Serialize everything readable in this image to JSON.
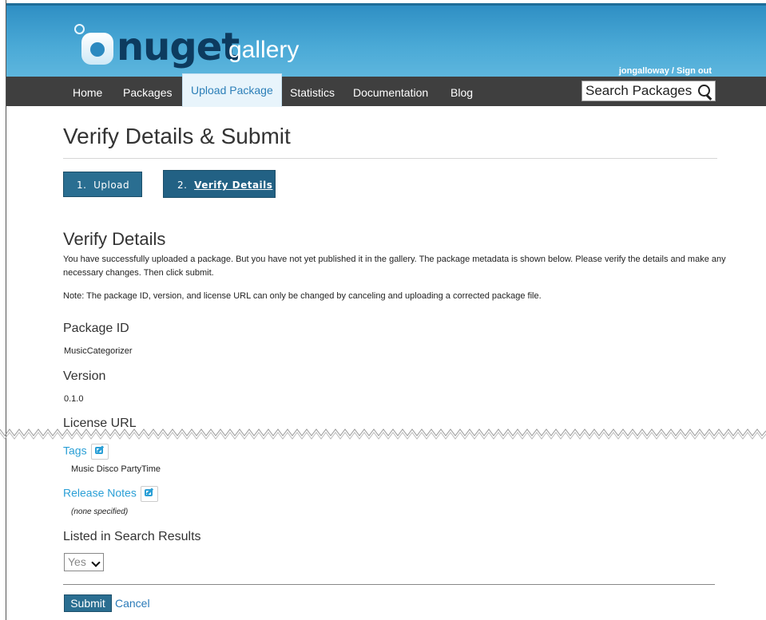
{
  "header": {
    "logo_text": "nuget",
    "logo_sub": "gallery",
    "user": "jongalloway",
    "separator": " / ",
    "sign_out": "Sign out"
  },
  "nav": {
    "items": [
      {
        "label": "Home"
      },
      {
        "label": "Packages"
      },
      {
        "label": "Upload Package"
      },
      {
        "label": "Statistics"
      },
      {
        "label": "Documentation"
      },
      {
        "label": "Blog"
      }
    ],
    "search_placeholder": "Search Packages"
  },
  "page": {
    "title": "Verify Details & Submit",
    "steps": [
      {
        "number": "1.",
        "label": "Upload"
      },
      {
        "number": "2.",
        "label": "Verify Details"
      }
    ],
    "section_title": "Verify Details",
    "intro": "You have successfully uploaded a package. But you have not yet published it in the gallery. The package metadata is shown below. Please verify the details and make any necessary changes. Then click submit.",
    "note": "Note: The package ID, version, and license URL can only be changed by canceling and uploading a corrected package file."
  },
  "fields": {
    "package_id_label": "Package ID",
    "package_id_value": "MusicCategorizer",
    "version_label": "Version",
    "version_value": "0.1.0",
    "license_label": "License URL",
    "tags_label": "Tags",
    "tags_value": "Music Disco PartyTime",
    "release_notes_label": "Release Notes",
    "release_notes_value": "(none specified)",
    "listed_label": "Listed in Search Results",
    "listed_value": "Yes"
  },
  "actions": {
    "submit": "Submit",
    "cancel": "Cancel"
  },
  "colors": {
    "header_blue": "#4aa9d6",
    "nav_dark": "#3f3f3f",
    "step_button": "#2a6e91",
    "link": "#2a9fd6"
  }
}
